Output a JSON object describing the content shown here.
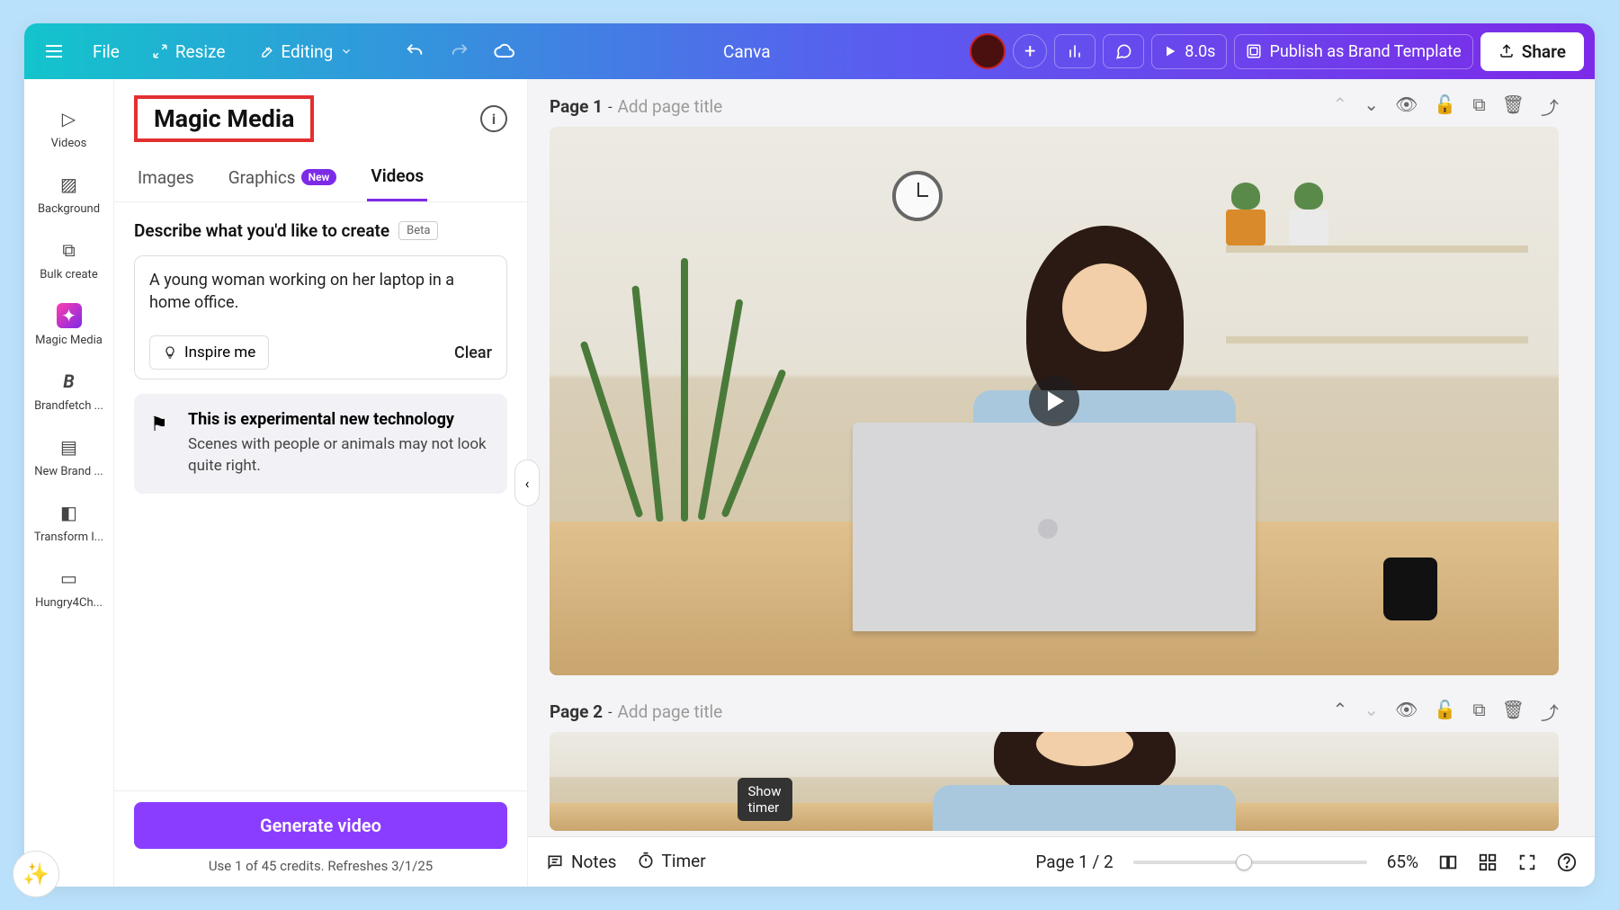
{
  "topbar": {
    "file": "File",
    "resize": "Resize",
    "editing": "Editing",
    "doc_title": "Canva",
    "duration": "8.0s",
    "publish": "Publish as Brand Template",
    "share": "Share"
  },
  "rail": {
    "items": [
      {
        "label": "Videos",
        "icon": "▷"
      },
      {
        "label": "Background",
        "icon": "▨"
      },
      {
        "label": "Bulk create",
        "icon": "⧉"
      },
      {
        "label": "Magic Media",
        "icon": "✦"
      },
      {
        "label": "Brandfetch ...",
        "icon": "B"
      },
      {
        "label": "New Brand ...",
        "icon": "≡"
      },
      {
        "label": "Transform I...",
        "icon": "◧"
      },
      {
        "label": "Hungry4Ch...",
        "icon": "▭"
      }
    ]
  },
  "panel": {
    "title": "Magic Media",
    "tabs": {
      "images": "Images",
      "graphics": "Graphics",
      "graphics_badge": "New",
      "videos": "Videos"
    },
    "describe_label": "Describe what you'd like to create",
    "beta": "Beta",
    "prompt": "A young woman working on her laptop in a home office.",
    "inspire": "Inspire me",
    "clear": "Clear",
    "notice_title": "This is experimental new technology",
    "notice_text": "Scenes with people or animals may not look quite right.",
    "generate": "Generate video",
    "credits": "Use 1 of 45 credits. Refreshes 3/1/25"
  },
  "pages": {
    "p1": {
      "label": "Page 1",
      "sep": " - ",
      "placeholder": "Add page title"
    },
    "p2": {
      "label": "Page 2",
      "sep": " - ",
      "placeholder": "Add page title"
    }
  },
  "bottom": {
    "notes": "Notes",
    "timer": "Timer",
    "timer_tip": "Show timer",
    "page_indicator": "Page 1 / 2",
    "zoom": "65%"
  }
}
